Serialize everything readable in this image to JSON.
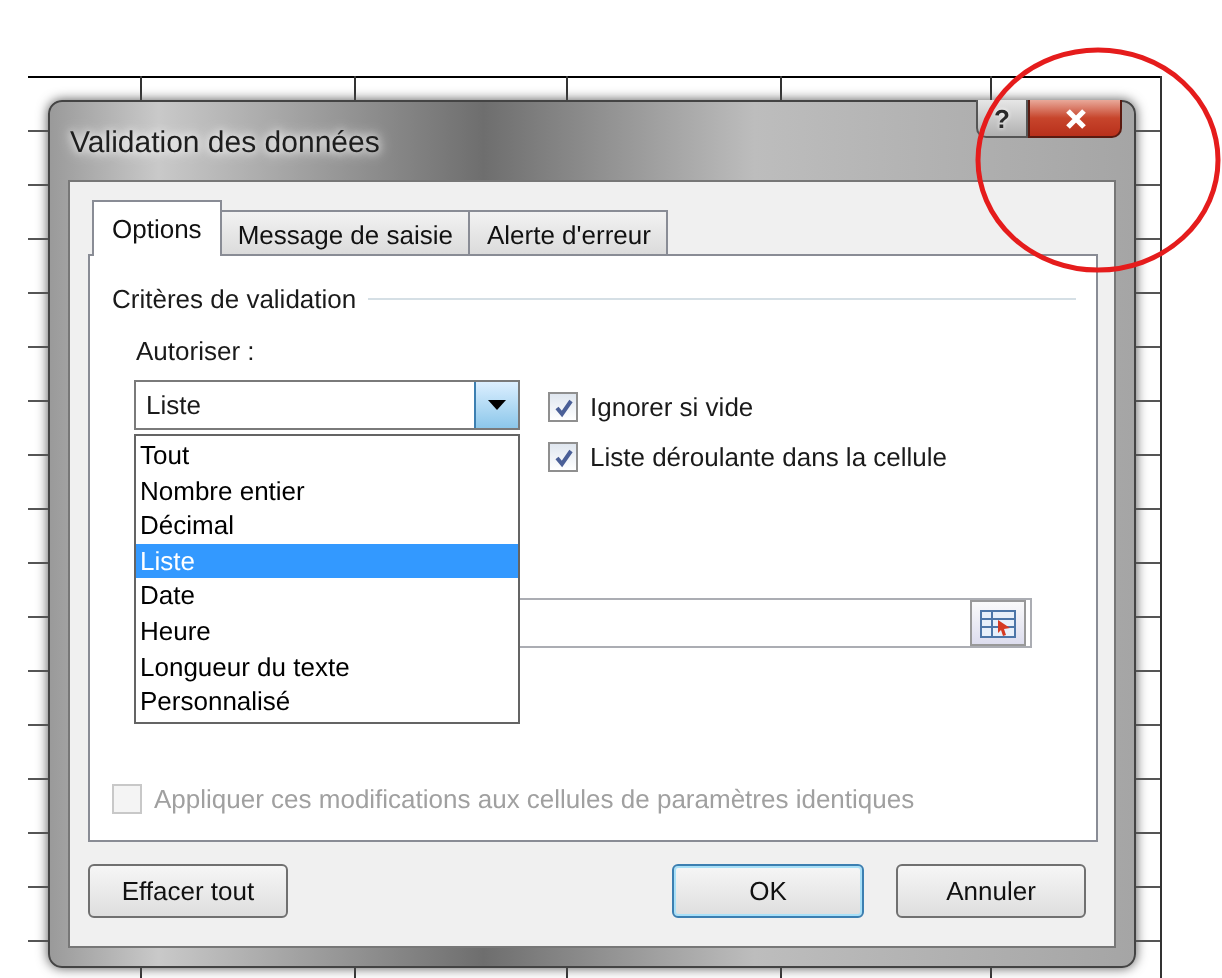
{
  "window": {
    "title": "Validation des données",
    "help_button": "?"
  },
  "tabs": [
    {
      "label": "Options",
      "selected": true
    },
    {
      "label": "Message de saisie",
      "selected": false
    },
    {
      "label": "Alerte d'erreur",
      "selected": false
    }
  ],
  "section_title": "Critères de validation",
  "allow": {
    "label": "Autoriser :",
    "value": "Liste",
    "expanded": true,
    "options": [
      {
        "label": "Tout",
        "selected": false
      },
      {
        "label": "Nombre entier",
        "selected": false
      },
      {
        "label": "Décimal",
        "selected": false
      },
      {
        "label": "Liste",
        "selected": true
      },
      {
        "label": "Date",
        "selected": false
      },
      {
        "label": "Heure",
        "selected": false
      },
      {
        "label": "Longueur du texte",
        "selected": false
      },
      {
        "label": "Personnalisé",
        "selected": false
      }
    ]
  },
  "checkboxes": [
    {
      "label": "Ignorer si vide",
      "checked": true,
      "disabled": false
    },
    {
      "label": "Liste déroulante dans la cellule",
      "checked": true,
      "disabled": false
    }
  ],
  "apply_all": {
    "label": "Appliquer ces modifications aux cellules de paramètres identiques",
    "checked": false,
    "disabled": true
  },
  "buttons": [
    {
      "label": "Effacer tout",
      "kind": "normal"
    },
    {
      "label": "OK",
      "kind": "default"
    },
    {
      "label": "Annuler",
      "kind": "normal"
    }
  ]
}
